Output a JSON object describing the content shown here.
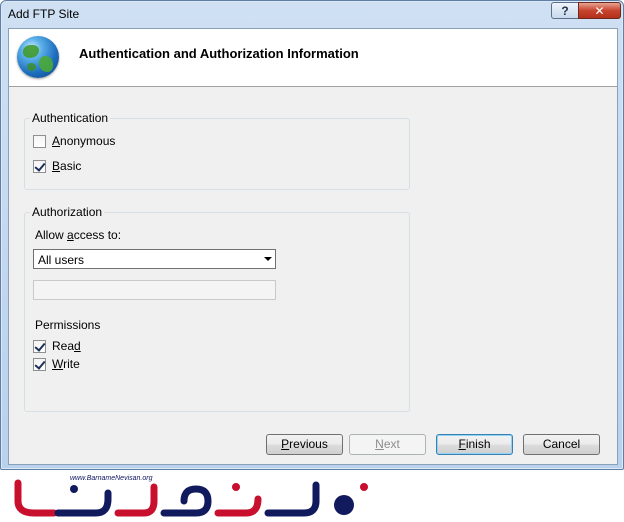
{
  "window": {
    "title": "Add FTP Site",
    "help_symbol": "?",
    "close_symbol": "✕"
  },
  "header": {
    "title": "Authentication and Authorization Information",
    "icon": "globe-icon"
  },
  "authentication": {
    "legend": "Authentication",
    "anonymous": {
      "accel": "A",
      "rest": "nonymous",
      "checked": false
    },
    "basic": {
      "accel": "B",
      "rest": "asic",
      "checked": true
    }
  },
  "authorization": {
    "legend": "Authorization",
    "allow_pre": "Allow ",
    "allow_accel": "a",
    "allow_post": "ccess to:",
    "selected": "All users",
    "permissions_label": "Permissions",
    "read": {
      "pre": "Rea",
      "accel": "d",
      "checked": true
    },
    "write": {
      "accel": "W",
      "rest": "rite",
      "checked": true
    }
  },
  "buttons": {
    "previous": {
      "accel": "P",
      "rest": "revious"
    },
    "next": {
      "accel": "N",
      "rest": "ext"
    },
    "finish": {
      "accel": "F",
      "rest": "inish"
    },
    "cancel": "Cancel"
  },
  "watermark": {
    "site": "www.BarnameNevisan.org"
  },
  "colors": {
    "logo_red": "#c8102e",
    "logo_navy": "#121a5e"
  }
}
